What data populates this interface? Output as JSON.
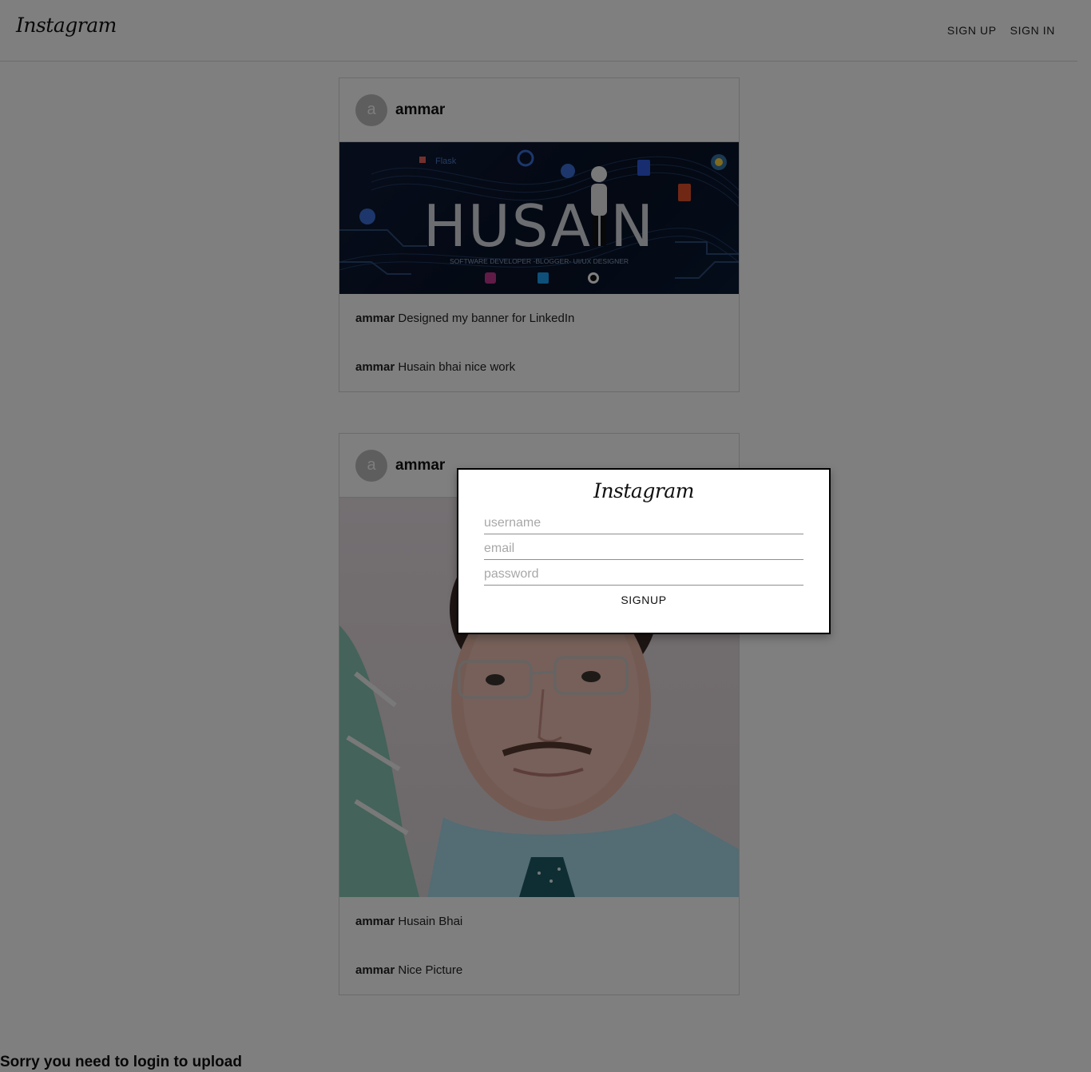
{
  "header": {
    "logo": "Instagram",
    "nav": {
      "signup_label": "SIGN UP",
      "signin_label": "SIGN IN"
    }
  },
  "posts": [
    {
      "avatar_letter": "a",
      "username": "ammar",
      "image_desc": "HUSAIN banner",
      "banner": {
        "title": "HUSAIN",
        "subtitle": "SOFTWARE DEVELOPER -BLOGGER- UI/UX DESIGNER"
      },
      "caption": {
        "user": "ammar",
        "text": "Designed my banner for LinkedIn"
      },
      "comments": [
        {
          "user": "ammar",
          "text": "Husain bhai nice work"
        }
      ]
    },
    {
      "avatar_letter": "a",
      "username": "ammar",
      "image_desc": "portrait photo",
      "caption": {
        "user": "ammar",
        "text": "Husain Bhai"
      },
      "comments": [
        {
          "user": "ammar",
          "text": "Nice Picture"
        }
      ]
    }
  ],
  "footer_message": "Sorry you need to login to upload",
  "modal": {
    "logo": "Instagram",
    "username_placeholder": "username",
    "email_placeholder": "email",
    "password_placeholder": "password",
    "signup_label": "SIGNUP"
  },
  "colors": {
    "overlay": "#000000",
    "border": "#d6d6d6",
    "avatar_bg": "#bdbdbd",
    "banner_bg": "#0d1a36"
  }
}
